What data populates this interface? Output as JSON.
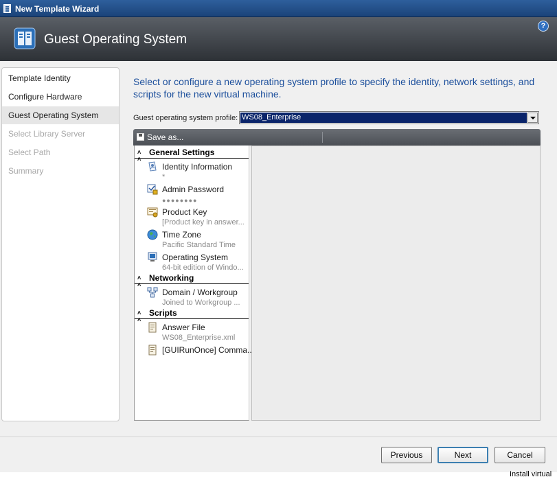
{
  "window": {
    "title": "New Template Wizard"
  },
  "banner": {
    "heading": "Guest Operating System",
    "help_icon": "?"
  },
  "nav": {
    "items": [
      {
        "label": "Template Identity",
        "state": "done"
      },
      {
        "label": "Configure Hardware",
        "state": "done"
      },
      {
        "label": "Guest Operating System",
        "state": "selected"
      },
      {
        "label": "Select Library Server",
        "state": "disabled"
      },
      {
        "label": "Select Path",
        "state": "disabled"
      },
      {
        "label": "Summary",
        "state": "disabled"
      }
    ]
  },
  "main": {
    "instructions": "Select or configure a new operating system profile to specify the identity, network settings, and scripts for the new virtual machine.",
    "profile_label": "Guest operating system profile:",
    "profile_value": "WS08_Enterprise"
  },
  "toolbar": {
    "save_label": "Save as..."
  },
  "settings": {
    "general": {
      "title": "General Settings",
      "items": [
        {
          "name": "Identity Information",
          "value": "*",
          "icon": "identity-icon"
        },
        {
          "name": "Admin Password",
          "value": "●●●●●●●●",
          "icon": "password-icon"
        },
        {
          "name": "Product Key",
          "value": "[Product key in answer...",
          "icon": "product-key-icon"
        },
        {
          "name": "Time Zone",
          "value": "Pacific Standard Time",
          "icon": "globe-icon"
        },
        {
          "name": "Operating System",
          "value": "64-bit edition of Windo...",
          "icon": "os-icon"
        }
      ]
    },
    "networking": {
      "title": "Networking",
      "items": [
        {
          "name": "Domain / Workgroup",
          "value": "Joined to Workgroup ...",
          "icon": "network-icon"
        }
      ]
    },
    "scripts": {
      "title": "Scripts",
      "items": [
        {
          "name": "Answer File",
          "value": "WS08_Enterprise.xml",
          "icon": "script-icon"
        },
        {
          "name": "[GUIRunOnce] Comma...",
          "value": "",
          "icon": "script-icon"
        }
      ]
    }
  },
  "footer": {
    "previous": "Previous",
    "next": "Next",
    "cancel": "Cancel"
  },
  "background": {
    "peek_text": "Install virtual"
  },
  "colors": {
    "accent_text": "#1c4f9c",
    "selection": "#0a246a",
    "banner_dark": "#2d3136"
  }
}
